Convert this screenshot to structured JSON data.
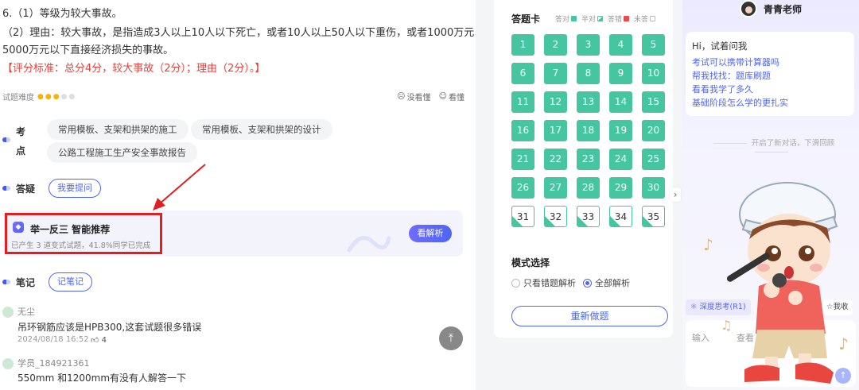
{
  "answer": {
    "line1": "6.（1）等级为较大事故。",
    "line2": "（2）理由：较大事故，是指造成3人以上10人以下死亡，或者10人以上50人以下重伤，或者1000万元以上",
    "line3": "5000万元以下直接经济损失的事故。",
    "grading": "【评分标准：总分4分，较大事故（2分）；理由（2分）。】"
  },
  "difficulty": {
    "label": "试题难度",
    "stars_on": 3,
    "stars_total": 5,
    "not_understood": "没看懂",
    "understood": "看懂"
  },
  "knowledge": {
    "label_line1": "考",
    "label_line2": "点",
    "tags": [
      "常用模板、支架和拱架的施工",
      "常用模板、支架和拱架的设计",
      "公路工程施工生产安全事故报告"
    ]
  },
  "qa": {
    "label": "答疑",
    "button": "我要提问"
  },
  "recommend": {
    "title": "举一反三 智能推荐",
    "subtitle": "已产生 3 道变式试题，41.8%同学已完成",
    "button": "看解析"
  },
  "notes": {
    "label": "笔记",
    "button": "记笔记"
  },
  "comments": [
    {
      "name": "无尘",
      "text": "吊环钢筋应该是HPB300,这套试题很多错误",
      "date": "2024/08/18 16:52",
      "likes": "4"
    },
    {
      "name": "学员_184921361",
      "text": "550mm  和1200mm有没有人解答一下"
    }
  ],
  "answer_card": {
    "title": "答题卡",
    "legend": [
      "答对",
      "半对",
      "答错",
      "未答"
    ],
    "legend_colors": [
      "#46c6a0",
      "#46c6a0",
      "#f04848",
      "#ffffff"
    ],
    "questions": [
      "1",
      "2",
      "3",
      "4",
      "5",
      "6",
      "7",
      "8",
      "9",
      "10",
      "11",
      "12",
      "13",
      "14",
      "15",
      "16",
      "17",
      "18",
      "19",
      "20",
      "21",
      "22",
      "23",
      "24",
      "25",
      "26",
      "27",
      "28",
      "29",
      "30",
      "31",
      "32",
      "33",
      "34",
      "35"
    ],
    "answered_count": 30,
    "mode_title": "模式选择",
    "mode_options": [
      "只看错题解析",
      "全部解析"
    ],
    "mode_selected": 1,
    "redo": "重新做题"
  },
  "chat": {
    "teacher": "青青老师",
    "greeting": "Hi，试着问我",
    "suggestions": [
      "考试可以携带计算器吗",
      "帮我找找：题库刷题",
      "看看我学了多久",
      "基础阶段怎么学的更扎实"
    ],
    "system_note": "开启了新对话，下滑回顾",
    "deep_think": "深度思考(R1)",
    "favorite": "我收",
    "input_placeholder": "输入",
    "input_placeholder2": "查看"
  }
}
